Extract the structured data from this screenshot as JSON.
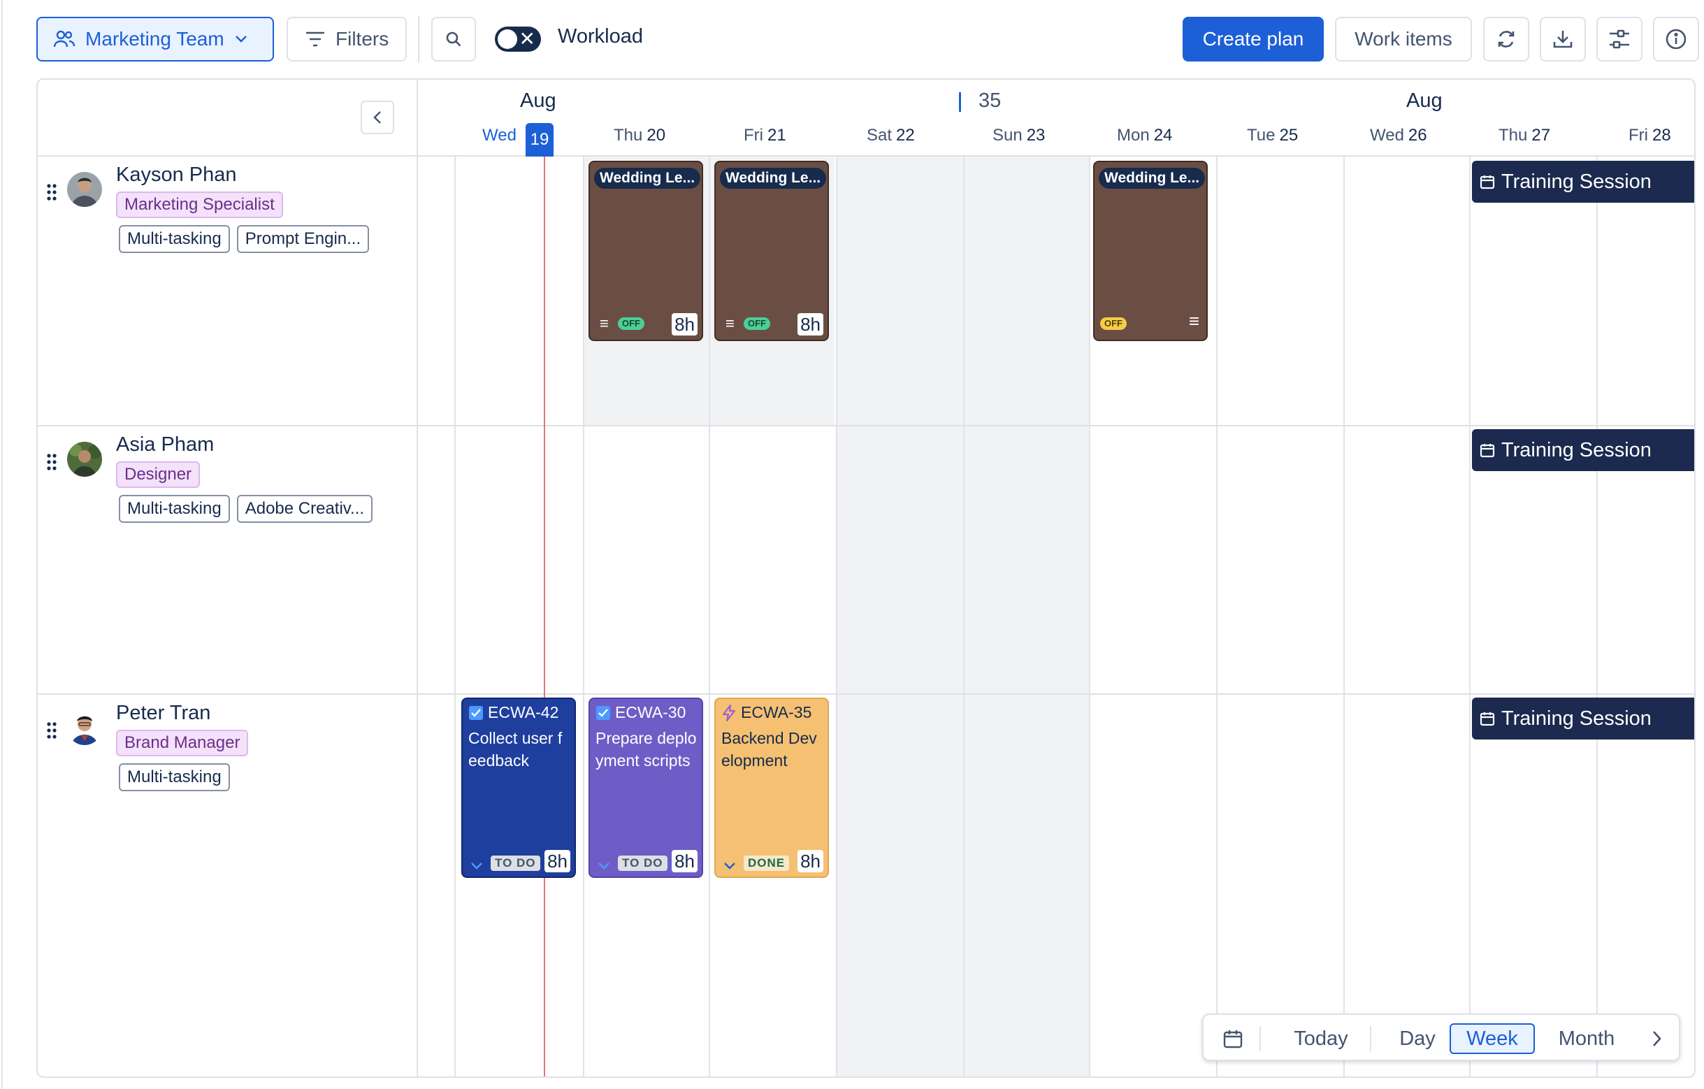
{
  "toolbar": {
    "team_label": "Marketing Team",
    "filters_label": "Filters",
    "workload_label": "Workload",
    "workload_toggle_on": false,
    "create_plan_label": "Create plan",
    "work_items_label": "Work items"
  },
  "timeline": {
    "months": [
      "Aug",
      "Aug"
    ],
    "week_number": "35",
    "today": {
      "day": "Wed",
      "date": "19"
    },
    "days": [
      {
        "day": "Thu",
        "date": "20"
      },
      {
        "day": "Fri",
        "date": "21"
      },
      {
        "day": "Sat",
        "date": "22"
      },
      {
        "day": "Sun",
        "date": "23"
      },
      {
        "day": "Mon",
        "date": "24"
      },
      {
        "day": "Tue",
        "date": "25"
      },
      {
        "day": "Wed",
        "date": "26"
      },
      {
        "day": "Thu",
        "date": "27"
      },
      {
        "day": "Fri",
        "date": "28"
      }
    ]
  },
  "people": [
    {
      "name": "Kayson Phan",
      "role": "Marketing Specialist",
      "skills": [
        "Multi-tasking",
        "Prompt Engin..."
      ]
    },
    {
      "name": "Asia Pham",
      "role": "Designer",
      "skills": [
        "Multi-tasking",
        "Adobe Creativ..."
      ]
    },
    {
      "name": "Peter Tran",
      "role": "Brand Manager",
      "skills": [
        "Multi-tasking"
      ]
    }
  ],
  "leave_cards": [
    {
      "title": "Wedding Le...",
      "status": "OFF",
      "hours": "8h"
    },
    {
      "title": "Wedding Le...",
      "status": "OFF",
      "hours": "8h"
    },
    {
      "title": "Wedding Le...",
      "status": "OFF"
    }
  ],
  "training": {
    "label": "Training Session"
  },
  "tasks": [
    {
      "key": "ECWA-42",
      "title": "Collect user feedback",
      "status": "TO DO",
      "hours": "8h"
    },
    {
      "key": "ECWA-30",
      "title": "Prepare deployment scripts",
      "status": "TO DO",
      "hours": "8h"
    },
    {
      "key": "ECWA-35",
      "title": "Backend Development",
      "status": "DONE",
      "hours": "8h"
    }
  ],
  "view_switcher": {
    "today_label": "Today",
    "day_label": "Day",
    "week_label": "Week",
    "month_label": "Month",
    "active": "Week"
  },
  "colors": {
    "accent": "#1d5fd6",
    "leave_card": "#6b4e43",
    "training": "#1b2a4e",
    "task_blue": "#1f3f9e",
    "task_purple": "#6e5dc6",
    "task_orange": "#f5c072",
    "today_line": "#e8737a"
  }
}
